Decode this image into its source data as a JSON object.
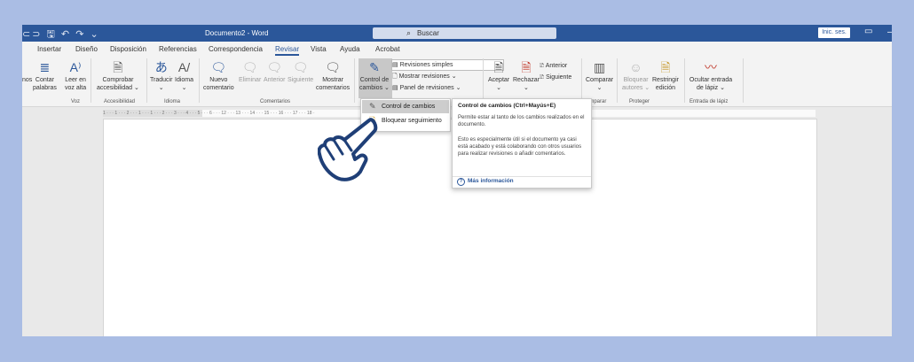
{
  "titlebar": {
    "quick_access": "⊂⊃ 🖫 ↶ ↷ ⌄",
    "document_title": "Documento2 - Word",
    "search_placeholder": "Buscar",
    "signin_label": "Inic. ses."
  },
  "tabs": [
    {
      "label": "Insertar"
    },
    {
      "label": "Diseño"
    },
    {
      "label": "Disposición"
    },
    {
      "label": "Referencias"
    },
    {
      "label": "Correspondencia"
    },
    {
      "label": "Revisar"
    },
    {
      "label": "Vista"
    },
    {
      "label": "Ayuda"
    },
    {
      "label": "Acrobat"
    }
  ],
  "ribbon": {
    "buttons": {
      "sinonimos": "nos",
      "contar": "Contar",
      "contar2": "palabras",
      "leer": "Leer en",
      "leer2": "voz alta",
      "comprobar": "Comprobar",
      "comprobar2": "accesibilidad ⌄",
      "traducir": "Traducir",
      "traducir2": "⌄",
      "idioma": "Idioma",
      "idioma2": "⌄",
      "nuevo": "Nuevo",
      "nuevo2": "comentario",
      "eliminar": "Eliminar",
      "anterior": "Anterior",
      "siguiente": "Siguiente",
      "mostrar": "Mostrar",
      "mostrar2": "comentarios",
      "control": "Control de",
      "control2": "cambios ⌄",
      "revisiones": "Revisiones simples",
      "mostrar_rev": "Mostrar revisiones ⌄",
      "panel": "Panel de revisiones ⌄",
      "aceptar": "Aceptar",
      "rechazar": "Rechazar",
      "anterior2": "Anterior",
      "siguiente2": "Siguiente",
      "comparar": "Comparar",
      "bloquear": "Bloquear",
      "bloquear2": "autores ⌄",
      "restringir": "Restringir",
      "restringir2": "edición",
      "ocultar": "Ocultar entrada",
      "ocultar2": "de lápiz ⌄"
    },
    "groups": {
      "voz": "Voz",
      "accesibilidad": "Accesibilidad",
      "idioma": "Idioma",
      "comentarios": "Comentarios",
      "comparar": "omparar",
      "proteger": "Proteger",
      "entrada": "Entrada de lápiz"
    }
  },
  "ruler_text": "1 · · · 1 · · · 2 · · · 1 · · · 1 · · · 2 · · · 3 · · · 4 · · · 5 · · · 6 · · · 12 · · · 13 · · · 14 · · · 15 · · · 16 · · · 17 · · · 18 ·",
  "dropdown": {
    "items": [
      {
        "label": "Control de cambios"
      },
      {
        "label": "Bloquear seguimiento"
      }
    ]
  },
  "tooltip": {
    "title": "Control de cambios (Ctrl+Mayús+E)",
    "para1": "Permite estar al tanto de los cambios realizados en el documento.",
    "para2": "Esto es especialmente útil si el documento ya casi está acabado y está colaborando con otros usuarios para realizar revisiones o añadir comentarios.",
    "more": "Más información"
  },
  "colors": {
    "accent": "#2b579a",
    "background": "#aabde4",
    "hand": "#1f3f77"
  },
  "icons": [
    "search-icon",
    "pointing-hand-icon",
    "track-changes-icon",
    "lock-icon",
    "help-icon"
  ]
}
